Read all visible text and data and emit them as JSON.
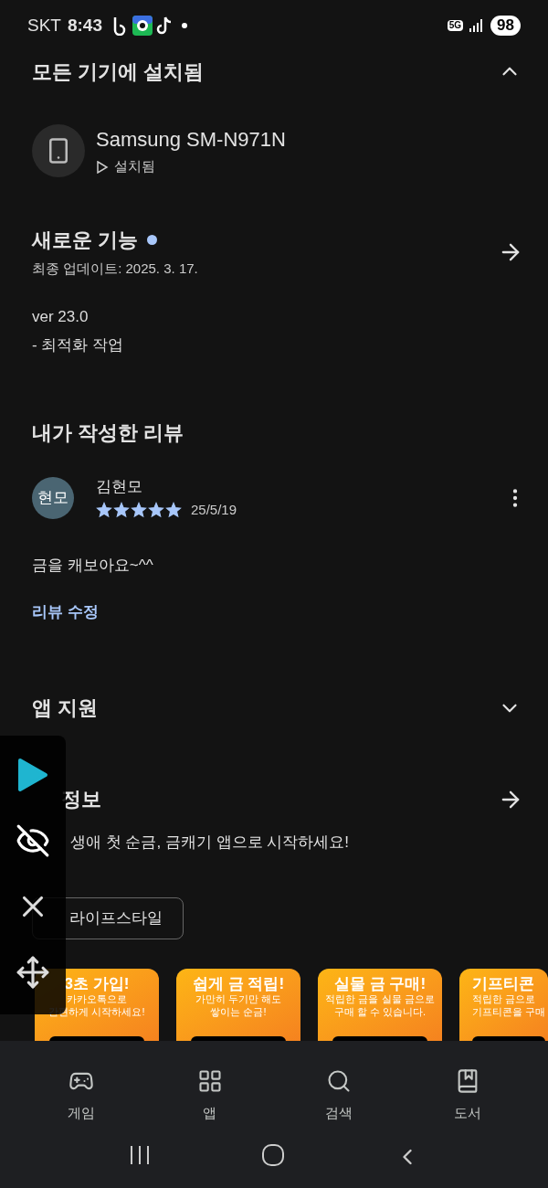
{
  "status_bar": {
    "carrier": "SKT",
    "time": "8:43",
    "network": "5G",
    "battery": "98"
  },
  "installed": {
    "title": "모든 기기에 설치됨",
    "expanded": true,
    "device": {
      "name": "Samsung SM-N971N",
      "status": "설치됨"
    }
  },
  "whats_new": {
    "title": "새로운 기능",
    "unread": true,
    "updated": "최종 업데이트: 2025. 3. 17.",
    "notes": [
      "ver 23.0",
      "- 최적화 작업"
    ]
  },
  "my_review": {
    "title": "내가 작성한 리뷰",
    "avatar": "현모",
    "author": "김현모",
    "stars": 5,
    "date": "25/5/19",
    "text": "금을 캐보아요~^^",
    "edit": "리뷰 수정"
  },
  "app_support": {
    "title": "앱 지원",
    "expanded": false
  },
  "app_info": {
    "title": "정보",
    "description": "생애 첫 순금, 금캐기 앱으로 시작하세요!",
    "category": "라이프스타일",
    "screenshots": [
      {
        "title": "3초 가입!",
        "lines": [
          "카카오톡으로",
          "간편하게 시작하세요!"
        ]
      },
      {
        "title": "쉽게 금 적립!",
        "lines": [
          "가만히 두기만 해도",
          "쌓이는 순금!"
        ]
      },
      {
        "title": "실물 금 구매!",
        "lines": [
          "적립한 금을 실물 금으로",
          "구매 할 수 있습니다."
        ]
      },
      {
        "title": "기프티콘",
        "lines": [
          "적립한 금으로",
          "기프티콘을 구매"
        ]
      }
    ]
  },
  "bottom_nav": [
    {
      "label": "게임",
      "kind": "game",
      "selected": false
    },
    {
      "label": "앱",
      "kind": "apps",
      "selected": false
    },
    {
      "label": "검색",
      "kind": "search",
      "selected": false
    },
    {
      "label": "도서",
      "kind": "books",
      "selected": false
    }
  ]
}
